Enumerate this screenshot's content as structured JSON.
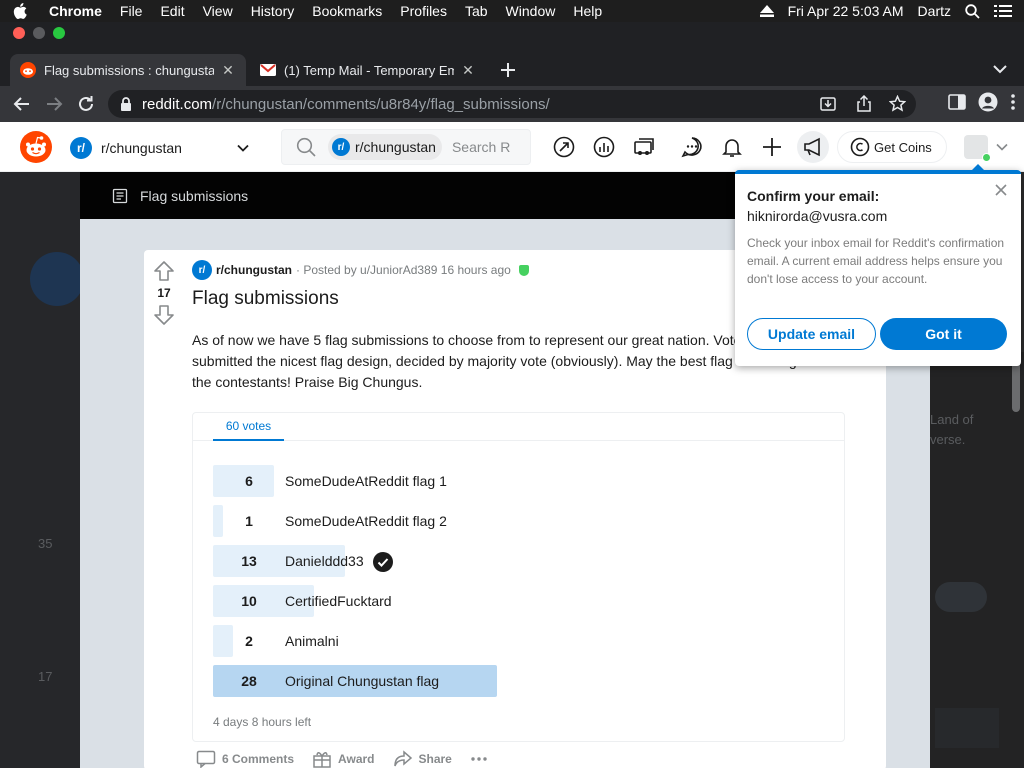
{
  "menubar": {
    "app": "Chrome",
    "items": [
      "File",
      "Edit",
      "View",
      "History",
      "Bookmarks",
      "Profiles",
      "Tab",
      "Window",
      "Help"
    ],
    "datetime": "Fri Apr 22  5:03 AM",
    "user": "Dartz"
  },
  "tabs": [
    {
      "title": "Flag submissions : chungustan",
      "active": true
    },
    {
      "title": "(1) Temp Mail - Temporary Ema",
      "active": false
    }
  ],
  "omnibox": {
    "host": "reddit.com",
    "path": "/r/chungustan/comments/u8r84y/flag_submissions/"
  },
  "reddit_header": {
    "community": "r/chungustan",
    "search_pill": "r/chungustan",
    "search_placeholder": "Search R",
    "get_coins": "Get Coins"
  },
  "modal": {
    "bar_title": "Flag submissions"
  },
  "post": {
    "score": "17",
    "subreddit": "r/chungustan",
    "posted_by": "· Posted by u/JuniorAd389 16 hours ago",
    "title": "Flag submissions",
    "body": "As of now we have 5 flag submissions to choose from to represent our great nation. Vote on who you think submitted the nicest flag design, decided by majority vote (obviously). May the best flag win and good luck to the contestants! Praise Big Chungus."
  },
  "poll": {
    "tab_label": "60 votes",
    "total_votes": 60,
    "options": [
      {
        "votes": 6,
        "label": "SomeDudeAtReddit flag 1",
        "voted": false
      },
      {
        "votes": 1,
        "label": "SomeDudeAtReddit flag 2",
        "voted": false
      },
      {
        "votes": 13,
        "label": "Danielddd33",
        "voted": true
      },
      {
        "votes": 10,
        "label": "CertifiedFucktard",
        "voted": false
      },
      {
        "votes": 2,
        "label": "Animalni",
        "voted": false
      },
      {
        "votes": 28,
        "label": "Original Chungustan flag",
        "voted": false
      }
    ],
    "time_left": "4 days 8 hours left"
  },
  "actions": {
    "comments": "6 Comments",
    "award": "Award",
    "share": "Share"
  },
  "popover": {
    "title": "Confirm your email:",
    "email": "hiknirorda@vusra.com",
    "text": "Check your inbox email for Reddit's confirmation email. A current email address helps ensure you don't lose access to your account.",
    "update_button": "Update email",
    "got_it_button": "Got it"
  },
  "background_peek": {
    "votes": [
      "35",
      "17"
    ],
    "right_text": [
      "Land of",
      "verse."
    ]
  },
  "colors": {
    "reddit_orange": "#ff4500",
    "reddit_blue": "#0079d3",
    "poll_bar": "#e4f0fa",
    "poll_bar_top": "#b6d6f1"
  }
}
